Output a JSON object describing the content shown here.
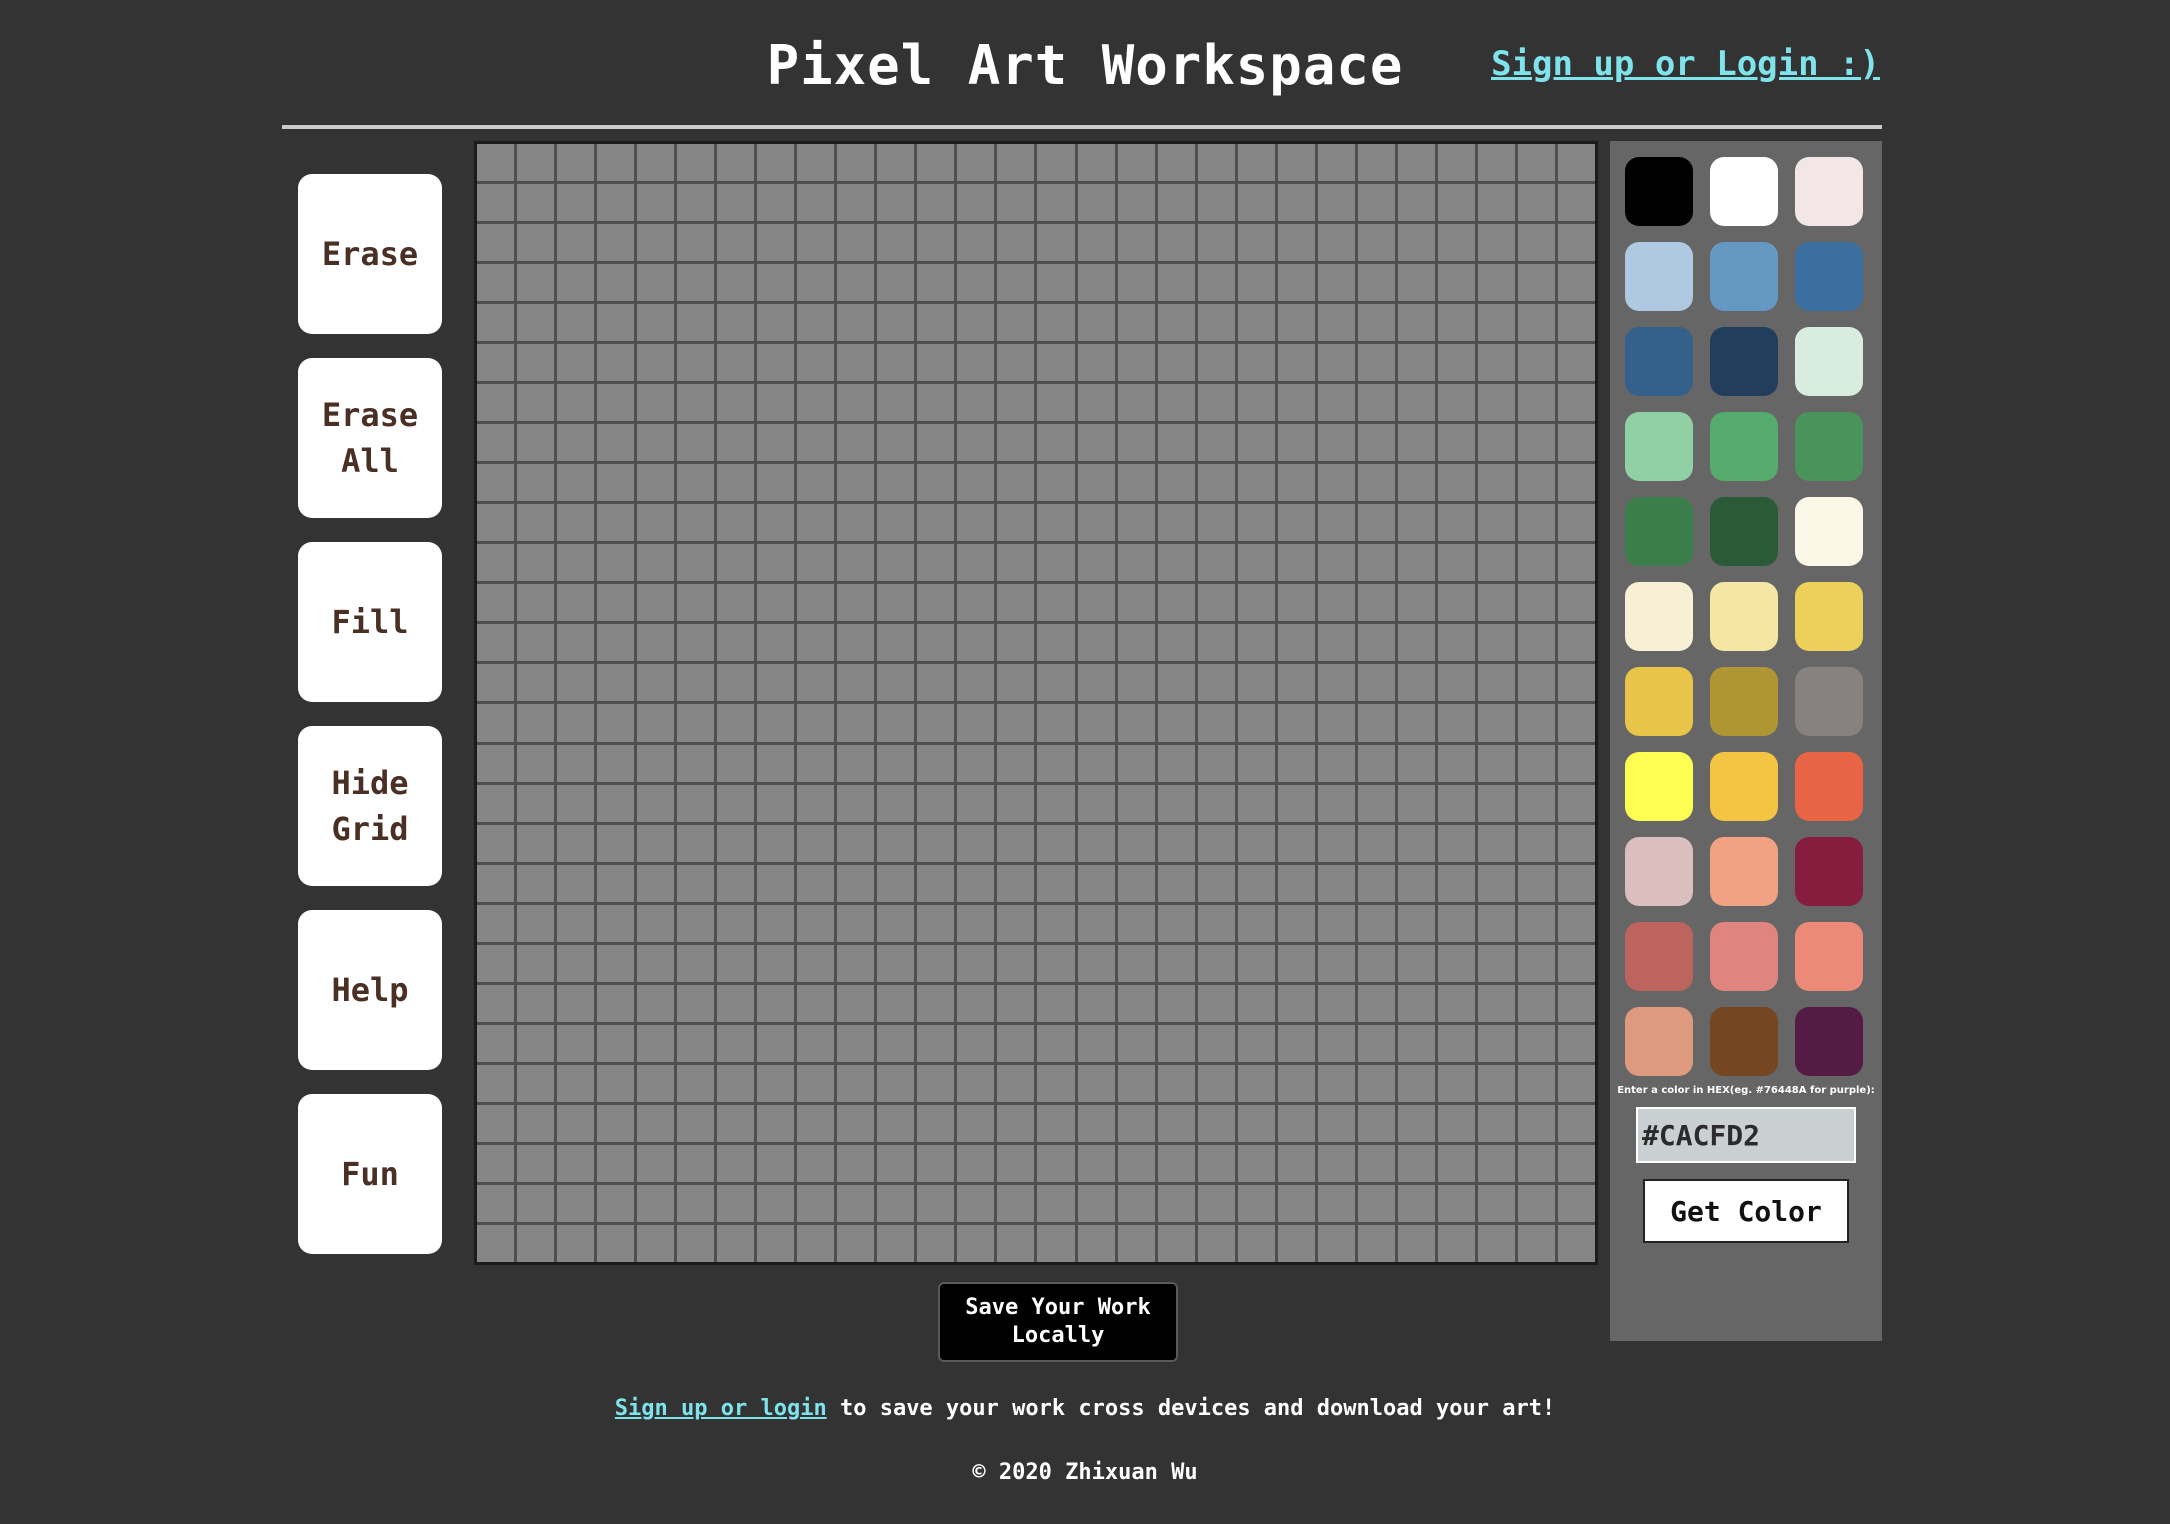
{
  "header": {
    "title": "Pixel Art Workspace",
    "auth_link": "Sign up or Login :)"
  },
  "tools": [
    {
      "name": "erase-button",
      "label": "Erase"
    },
    {
      "name": "erase-all-button",
      "label": "Erase\nAll"
    },
    {
      "name": "fill-button",
      "label": "Fill"
    },
    {
      "name": "hide-grid-button",
      "label": "Hide\nGrid"
    },
    {
      "name": "help-button",
      "label": "Help"
    },
    {
      "name": "fun-button",
      "label": "Fun"
    }
  ],
  "canvas": {
    "rows": 28,
    "columns": 28,
    "cell_color": "#868686",
    "grid_line_color": "#4f4f4f"
  },
  "save_button": "Save Your Work\nLocally",
  "palette": {
    "colors": [
      "#000000",
      "#ffffff",
      "#f3e6e6",
      "#aec9e1",
      "#6597c3",
      "#3a6f9f",
      "#33618c",
      "#213f5c",
      "#d8ece0",
      "#91cfa5",
      "#55ab6b",
      "#4a935a",
      "#3c7e4b",
      "#2a5a37",
      "#fbf7e6",
      "#f8f0d4",
      "#f5e6a5",
      "#edd05a",
      "#e8c548",
      "#b09534",
      "#878280",
      "#fdfd52",
      "#f4c443",
      "#e96445",
      "#dbbfbe",
      "#f0a282",
      "#861d3e",
      "#bd645f",
      "#e0847f",
      "#ec8a77",
      "#dd9a7e",
      "#744722",
      "#541c45"
    ],
    "hex_prompt": "Enter a color in HEX(eg. #76448A for purple):",
    "hex_value": "#CACFD2",
    "get_color_label": "Get Color"
  },
  "footer": {
    "link_text": "Sign up or login",
    "text": " to save your work cross devices and download your art!",
    "copyright": "© 2020 Zhixuan Wu"
  }
}
